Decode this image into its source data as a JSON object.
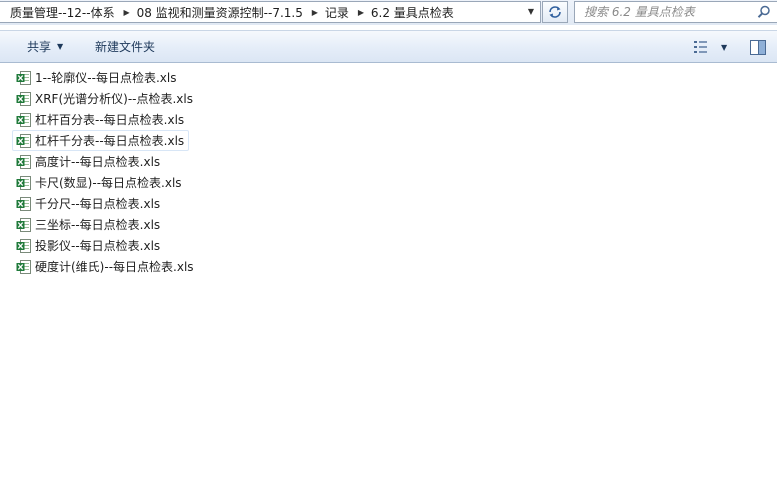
{
  "address_bar": {
    "breadcrumbs": [
      {
        "label": "质量管理--12--体系"
      },
      {
        "label": "08 监视和测量资源控制--7.1.5"
      },
      {
        "label": "记录"
      },
      {
        "label": "6.2 量具点检表"
      }
    ],
    "search_placeholder": "搜索 6.2 量具点检表"
  },
  "toolbar": {
    "share_label": "共享",
    "new_folder_label": "新建文件夹"
  },
  "files": [
    {
      "name": "1--轮廓仪--每日点检表.xls"
    },
    {
      "name": "XRF(光谱分析仪)--点检表.xls"
    },
    {
      "name": "杠杆百分表--每日点检表.xls"
    },
    {
      "name": "杠杆千分表--每日点检表.xls",
      "focused": true
    },
    {
      "name": "高度计--每日点检表.xls"
    },
    {
      "name": "卡尺(数显)--每日点检表.xls"
    },
    {
      "name": "千分尺--每日点检表.xls"
    },
    {
      "name": "三坐标--每日点检表.xls"
    },
    {
      "name": "投影仪--每日点检表.xls"
    },
    {
      "name": "硬度计(维氏)--每日点检表.xls"
    }
  ],
  "icons": {
    "file": "excel-file-icon",
    "refresh": "refresh-icon",
    "search": "search-icon",
    "view": "view-options-icon",
    "preview": "preview-pane-icon"
  },
  "colors": {
    "toolbar_text": "#1e395b",
    "excel_green": "#1f7a3a"
  }
}
